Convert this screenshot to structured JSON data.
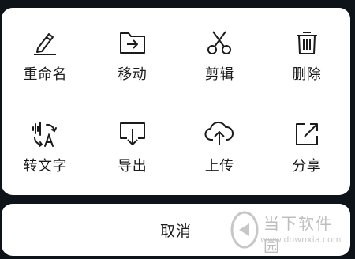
{
  "actions": [
    {
      "label": "重命名",
      "icon": "pencil-icon"
    },
    {
      "label": "移动",
      "icon": "move-folder-icon"
    },
    {
      "label": "剪辑",
      "icon": "scissors-icon"
    },
    {
      "label": "删除",
      "icon": "trash-icon"
    },
    {
      "label": "转文字",
      "icon": "voice-to-text-icon"
    },
    {
      "label": "导出",
      "icon": "export-icon"
    },
    {
      "label": "上传",
      "icon": "cloud-upload-icon"
    },
    {
      "label": "分享",
      "icon": "share-icon"
    }
  ],
  "cancel_label": "取消",
  "watermark": {
    "title": "当下软件园",
    "url": "www.downxia.com"
  },
  "colors": {
    "background": "#0d1319",
    "sheet": "#ffffff",
    "text": "#1b1b1b"
  }
}
